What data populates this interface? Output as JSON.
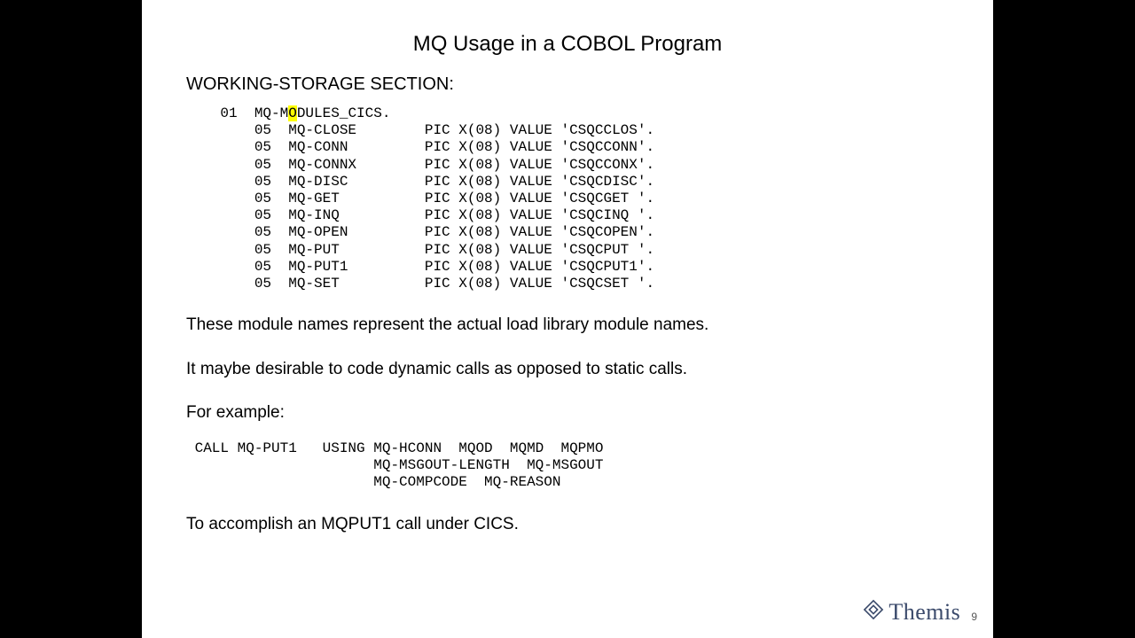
{
  "title": "MQ Usage in a COBOL Program",
  "section_heading": "WORKING-STORAGE SECTION:",
  "code1_prefix": "    01  MQ-M",
  "code1_hl": "O",
  "code1_rest": "DULES_CICS.\n        05  MQ-CLOSE        PIC X(08) VALUE 'CSQCCLOS'.\n        05  MQ-CONN         PIC X(08) VALUE 'CSQCCONN'.\n        05  MQ-CONNX        PIC X(08) VALUE 'CSQCCONX'.\n        05  MQ-DISC         PIC X(08) VALUE 'CSQCDISC'.\n        05  MQ-GET          PIC X(08) VALUE 'CSQCGET '.\n        05  MQ-INQ          PIC X(08) VALUE 'CSQCINQ '.\n        05  MQ-OPEN         PIC X(08) VALUE 'CSQCOPEN'.\n        05  MQ-PUT          PIC X(08) VALUE 'CSQCPUT '.\n        05  MQ-PUT1         PIC X(08) VALUE 'CSQCPUT1'.\n        05  MQ-SET          PIC X(08) VALUE 'CSQCSET '.",
  "para1": "These module names represent the actual load library module names.",
  "para2": "It maybe desirable to code dynamic calls as opposed to static calls.",
  "para3": "For example:",
  "code2": " CALL MQ-PUT1   USING MQ-HCONN  MQOD  MQMD  MQPMO\n                      MQ-MSGOUT-LENGTH  MQ-MSGOUT\n                      MQ-COMPCODE  MQ-REASON",
  "para4": "To accomplish an MQPUT1 call under CICS.",
  "brand": "Themis",
  "page_number": "9"
}
